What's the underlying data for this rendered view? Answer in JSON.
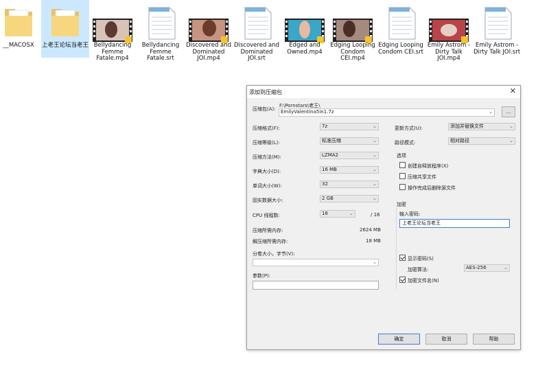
{
  "files": [
    {
      "name": "__MACOSX",
      "type": "folder"
    },
    {
      "name": "上老王论坛当老王",
      "type": "folder"
    },
    {
      "name": "Bellydancing Femme Fatale.mp4",
      "type": "video"
    },
    {
      "name": "Bellydancing Femme Fatale.srt",
      "type": "text"
    },
    {
      "name": "Discovered and Dominated JOI.mp4",
      "type": "video"
    },
    {
      "name": "Discovered and Dominated JOI.srt",
      "type": "text"
    },
    {
      "name": "Edged and Owned.mp4",
      "type": "video"
    },
    {
      "name": "Edging Looping Condom CEI.mp4",
      "type": "video"
    },
    {
      "name": "Edging Looping Condom CEI.srt",
      "type": "text"
    },
    {
      "name": "Emily Astrom - Dirty Talk JOI.mp4",
      "type": "video"
    },
    {
      "name": "Emily Astrom - Dirty Talk JOI.srt",
      "type": "text"
    }
  ],
  "dialog": {
    "title": "添加到压缩包",
    "close_glyph": "✕",
    "archive_label": "压缩包(A):",
    "archive_path": "F:\\Pornstars\\老王\\",
    "archive_name": "EmilyValentina5in1.7z",
    "browse_label": "...",
    "format_label": "压缩格式(F):",
    "format_value": "7z",
    "level_label": "压缩等级(L):",
    "level_value": "标准压缩",
    "method_label": "压缩方法(M):",
    "method_value": "LZMA2",
    "dict_label": "字典大小(D):",
    "dict_value": "16 MB",
    "word_label": "单词大小(W):",
    "word_value": "32",
    "solid_label": "固实数据大小:",
    "solid_value": "2 GB",
    "threads_label": "CPU 线程数:",
    "threads_value": "16",
    "threads_total": "/ 16",
    "mem_compress_label": "压缩所需内存:",
    "mem_compress_value": "2624 MB",
    "mem_decompress_label": "解压缩所需内存:",
    "mem_decompress_value": "18 MB",
    "split_label": "分卷大小，字节(V):",
    "split_value": "",
    "params_label": "参数(P):",
    "params_value": "",
    "update_label": "更新方式(U):",
    "update_value": "添加并替换文件",
    "path_label": "路径模式:",
    "path_value": "相对路径",
    "options_label": "选项",
    "opt_sfx": "创建自释放程序(X)",
    "opt_shared": "压缩共享文件",
    "opt_delete": "操作完成后删除源文件",
    "encrypt_label": "加密",
    "password_label": "输入密码:",
    "password_value": "上老王论坛当老王",
    "show_password": "显示密码(S)",
    "enc_method_label": "加密算法:",
    "enc_method_value": "AES-256",
    "encrypt_names": "加密文件名(N)",
    "ok": "确定",
    "cancel": "取消",
    "help": "帮助"
  },
  "arrow_glyph": "⌄"
}
